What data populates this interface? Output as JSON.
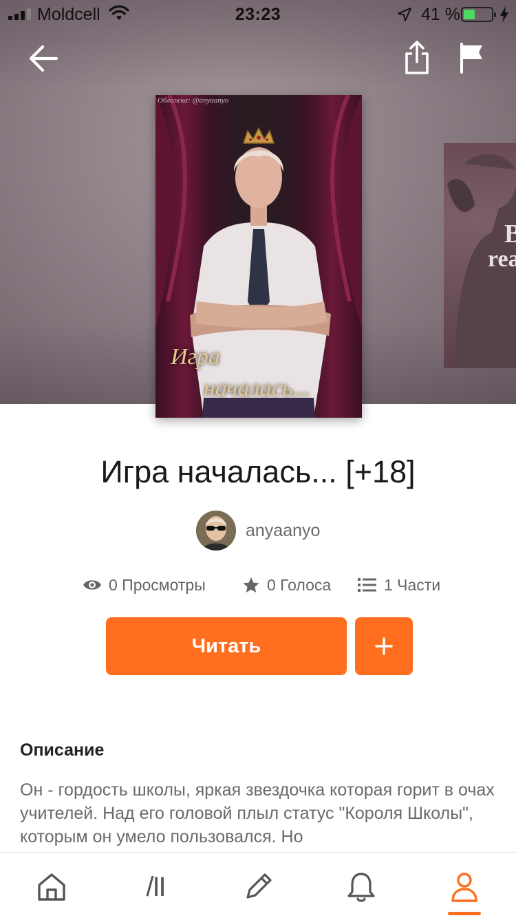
{
  "status_bar": {
    "carrier": "Moldcell",
    "time": "23:23",
    "battery_percent": "41 %",
    "battery_level": 0.41
  },
  "cover": {
    "credit": "Обложка: @anyaanyo",
    "title_line_1": "Игра",
    "title_line_2": "началась..."
  },
  "next_cover": {
    "text_1": "B",
    "text_2": "rea"
  },
  "story": {
    "title": "Игра началась... [+18]",
    "author": "anyaanyo"
  },
  "stats": {
    "views": "0 Просмотры",
    "votes": "0 Голоса",
    "parts": "1 Части"
  },
  "actions": {
    "read_label": "Читать"
  },
  "description": {
    "heading": "Описание",
    "text": "Он -  гордость школы, яркая звездочка которая горит в очах учителей. Над его головой плыл статус \"Короля Школы\", которым он умело пользовался. Но"
  },
  "tabbar": {
    "items": [
      "home-icon",
      "library-icon",
      "pencil-icon",
      "bell-icon",
      "profile-icon"
    ],
    "active": "profile",
    "library_glyph": "/II"
  },
  "colors": {
    "accent": "#ff6e1f",
    "battery": "#4cd964"
  }
}
